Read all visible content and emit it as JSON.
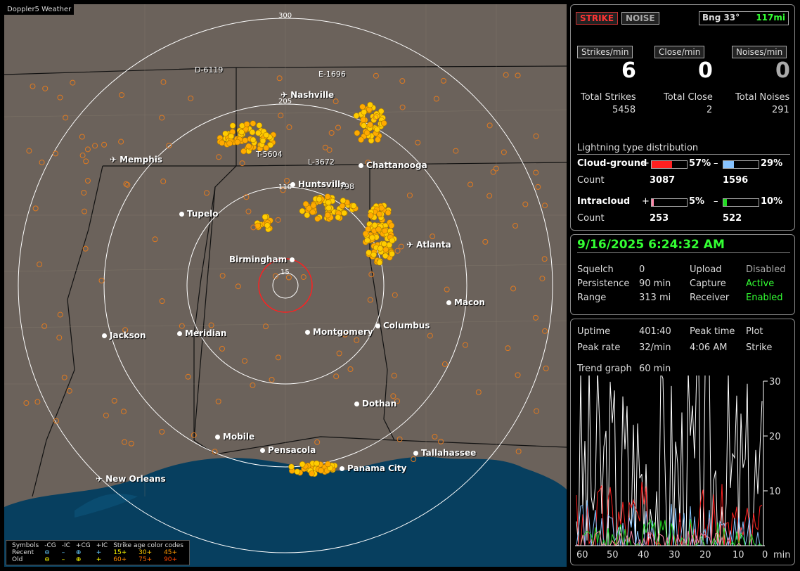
{
  "map": {
    "title": "Doppler5 Weather",
    "rings": [
      "300",
      "205",
      "110",
      "15"
    ],
    "cities": [
      {
        "name": "Nashville",
        "icon": "plane"
      },
      {
        "name": "Memphis",
        "icon": "plane"
      },
      {
        "name": "Chattanooga",
        "icon": "dot"
      },
      {
        "name": "Huntsville",
        "icon": "dot"
      },
      {
        "name": "Tupelo",
        "icon": "dot"
      },
      {
        "name": "Atlanta",
        "icon": "plane"
      },
      {
        "name": "Birmingham",
        "icon": "dot"
      },
      {
        "name": "Macon",
        "icon": "dot"
      },
      {
        "name": "Jackson",
        "icon": "plane"
      },
      {
        "name": "Meridian",
        "icon": "dot"
      },
      {
        "name": "Montgomery",
        "icon": "dot"
      },
      {
        "name": "Columbus",
        "icon": "dot"
      },
      {
        "name": "Dothan",
        "icon": "dot"
      },
      {
        "name": "Mobile",
        "icon": "dot"
      },
      {
        "name": "Pensacola",
        "icon": "dot"
      },
      {
        "name": "Tallahassee",
        "icon": "dot"
      },
      {
        "name": "Panama City",
        "icon": "dot"
      },
      {
        "name": "New Orleans",
        "icon": "plane"
      }
    ],
    "storm_labels": [
      "D-6119",
      "E-1696",
      "T-5604",
      "L-3672",
      "798"
    ],
    "legend": {
      "header": [
        "Symbols",
        "-CG",
        "-IC",
        "+CG",
        "+IC",
        "Strike age color codes"
      ],
      "recent_label": "Recent",
      "old_label": "Old",
      "recent_ages": [
        "15+",
        "30+",
        "45+"
      ],
      "old_ages": [
        "60+",
        "75+",
        "90+"
      ]
    }
  },
  "status": {
    "strike_btn": "STRIKE",
    "noise_btn": "NOISE",
    "bearing": "Bng 33°",
    "distance": "117mi",
    "strikes_min_label": "Strikes/min",
    "close_min_label": "Close/min",
    "noises_min_label": "Noises/min",
    "strikes_min": "6",
    "close_min": "0",
    "noises_min": "0",
    "total_strikes_label": "Total Strikes",
    "total_close_label": "Total Close",
    "total_noises_label": "Total Noises",
    "total_strikes": "5458",
    "total_close": "2",
    "total_noises": "291",
    "dist_title": "Lightning type distribution",
    "cg_label": "Cloud-ground",
    "ic_label": "Intracloud",
    "count_label": "Count",
    "cg_pos_pct": "57%",
    "cg_neg_pct": "29%",
    "cg_pos_count": "3087",
    "cg_neg_count": "1596",
    "ic_pos_pct": "5%",
    "ic_neg_pct": "10%",
    "ic_pos_count": "253",
    "ic_neg_count": "522",
    "plus": "+",
    "minus": "–",
    "cg_pos_fill": 0.57,
    "cg_neg_fill": 0.29,
    "ic_pos_fill": 0.05,
    "ic_neg_fill": 0.1
  },
  "info": {
    "datetime": "9/16/2025 6:24:32 AM",
    "squelch_label": "Squelch",
    "squelch": "0",
    "persistence_label": "Persistence",
    "persistence": "90 min",
    "range_label": "Range",
    "range": "313 mi",
    "upload_label": "Upload",
    "upload": "Disabled",
    "capture_label": "Capture",
    "capture": "Active",
    "receiver_label": "Receiver",
    "receiver": "Enabled"
  },
  "trend": {
    "uptime_label": "Uptime",
    "uptime": "401:40",
    "peak_time_label": "Peak time",
    "peak_time": "4:06 AM",
    "plot_label": "Plot",
    "plot": "Strike",
    "peak_rate_label": "Peak rate",
    "peak_rate": "32/min",
    "trend_graph_label": "Trend graph",
    "trend_graph": "60 min",
    "y_ticks": [
      "30",
      "20",
      "10",
      "0"
    ],
    "x_ticks": [
      "60",
      "50",
      "40",
      "30",
      "20",
      "10",
      "0"
    ],
    "x_unit": "min"
  },
  "colors": {
    "strike_cluster": "#ffcc00",
    "old_strike": "#e07a20",
    "accent_green": "#33ff33",
    "bar_cg_pos": "#ff2020",
    "bar_cg_neg": "#88c4ff",
    "bar_ic_pos": "#ff88aa",
    "bar_ic_neg": "#22dd22"
  }
}
